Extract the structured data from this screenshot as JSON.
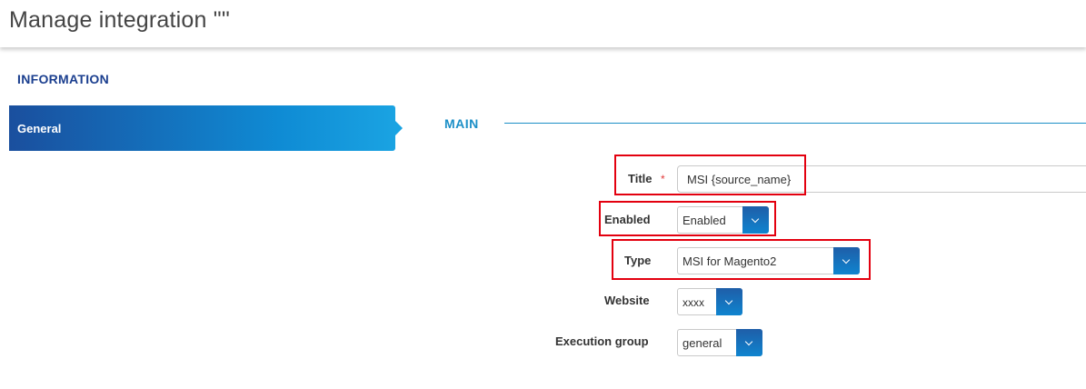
{
  "header": {
    "title": "Manage integration \"\""
  },
  "sidebar": {
    "section_title": "INFORMATION",
    "tabs": [
      {
        "label": "General",
        "active": true
      }
    ]
  },
  "main": {
    "section_title": "MAIN",
    "fields": {
      "title": {
        "label": "Title",
        "required_mark": "*",
        "value": "MSI {source_name}"
      },
      "enabled": {
        "label": "Enabled",
        "value": "Enabled"
      },
      "type": {
        "label": "Type",
        "value": "MSI for Magento2"
      },
      "website": {
        "label": "Website",
        "value": "xxxx"
      },
      "execution_group": {
        "label": "Execution group",
        "value": "general"
      }
    }
  },
  "colors": {
    "accent": "#1c8fc7",
    "tab_gradient_start": "#1a4f9e",
    "tab_gradient_end": "#1aa3e2",
    "highlight": "#e3000f",
    "required": "#e23a3a"
  }
}
